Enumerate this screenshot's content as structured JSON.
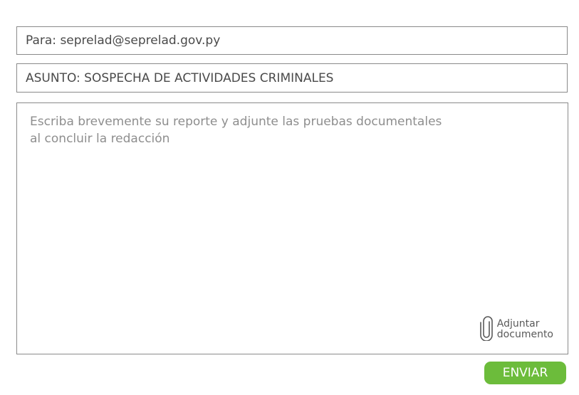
{
  "to_field": {
    "value": "Para: seprelad@seprelad.gov.py"
  },
  "subject_field": {
    "value": "ASUNTO: SOSPECHA DE ACTIVIDADES CRIMINALES"
  },
  "body": {
    "placeholder": "Escriba brevemente su reporte y adjunte las pruebas documentales\nal concluir  la redacción"
  },
  "attach": {
    "icon": "paperclip-icon",
    "label": "Adjuntar\ndocumento"
  },
  "send_button": {
    "label": "ENVIAR",
    "color": "#6cbc3b"
  }
}
